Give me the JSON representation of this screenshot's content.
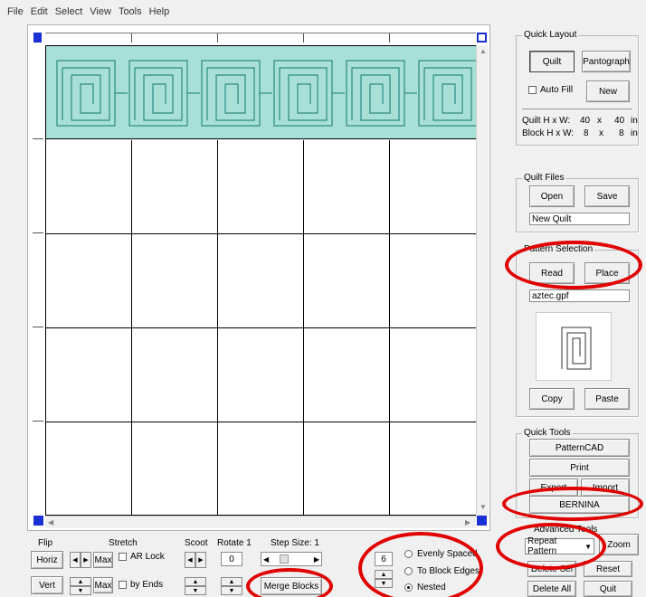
{
  "menu": [
    "File",
    "Edit",
    "Select",
    "View",
    "Tools",
    "Help"
  ],
  "quick_layout": {
    "legend": "Quick Layout",
    "quilt_label": "Quilt",
    "pantograph_label": "Pantograph",
    "autofill_label": "Auto Fill",
    "new_label": "New",
    "quilt_hw_label": "Quilt H x W:",
    "quilt_h": "40",
    "quilt_x": "x",
    "quilt_w": "40",
    "quilt_unit": "in",
    "block_hw_label": "Block H x W:",
    "block_h": "8",
    "block_x": "x",
    "block_w": "8",
    "block_unit": "in"
  },
  "quilt_files": {
    "legend": "Quilt Files",
    "open_label": "Open",
    "save_label": "Save",
    "filename": "New Quilt"
  },
  "pattern_selection": {
    "legend": "Pattern Selection",
    "read_label": "Read",
    "place_label": "Place",
    "filename": "aztec.gpf",
    "copy_label": "Copy",
    "paste_label": "Paste"
  },
  "quick_tools": {
    "legend": "Quick Tools",
    "patterncad_label": "PatternCAD",
    "print_label": "Print",
    "export_label": "Export",
    "import_label": "Import",
    "bernina_label": "BERNINA"
  },
  "advanced_tools": {
    "legend": "Advanced Tools",
    "dropdown_value": "Repeat Pattern",
    "zoom_label": "Zoom",
    "delete_sel_label": "Delete Sel",
    "reset_label": "Reset",
    "delete_all_label": "Delete All",
    "quit_label": "Quit"
  },
  "bottom_controls": {
    "flip_label": "Flip",
    "horiz_label": "Horiz",
    "vert_label": "Vert",
    "stretch_label": "Stretch",
    "max_label": "Max",
    "max2_label": "Max",
    "ar_lock_label": "AR Lock",
    "by_ends_label": "by Ends",
    "scoot_label": "Scoot",
    "rotate_label": "Rotate 1",
    "rotate_value": "0",
    "step_size_label": "Step Size: 1",
    "merge_blocks_label": "Merge Blocks",
    "count_value": "6",
    "evenly_spaced_label": "Evenly Spaced",
    "to_block_edges_label": "To Block Edges",
    "nested_label": "Nested"
  },
  "colors": {
    "pattern_fill": "#a8e0d8",
    "highlight_oval": "#e00000",
    "ruler_marker": "#1a2fd4"
  }
}
